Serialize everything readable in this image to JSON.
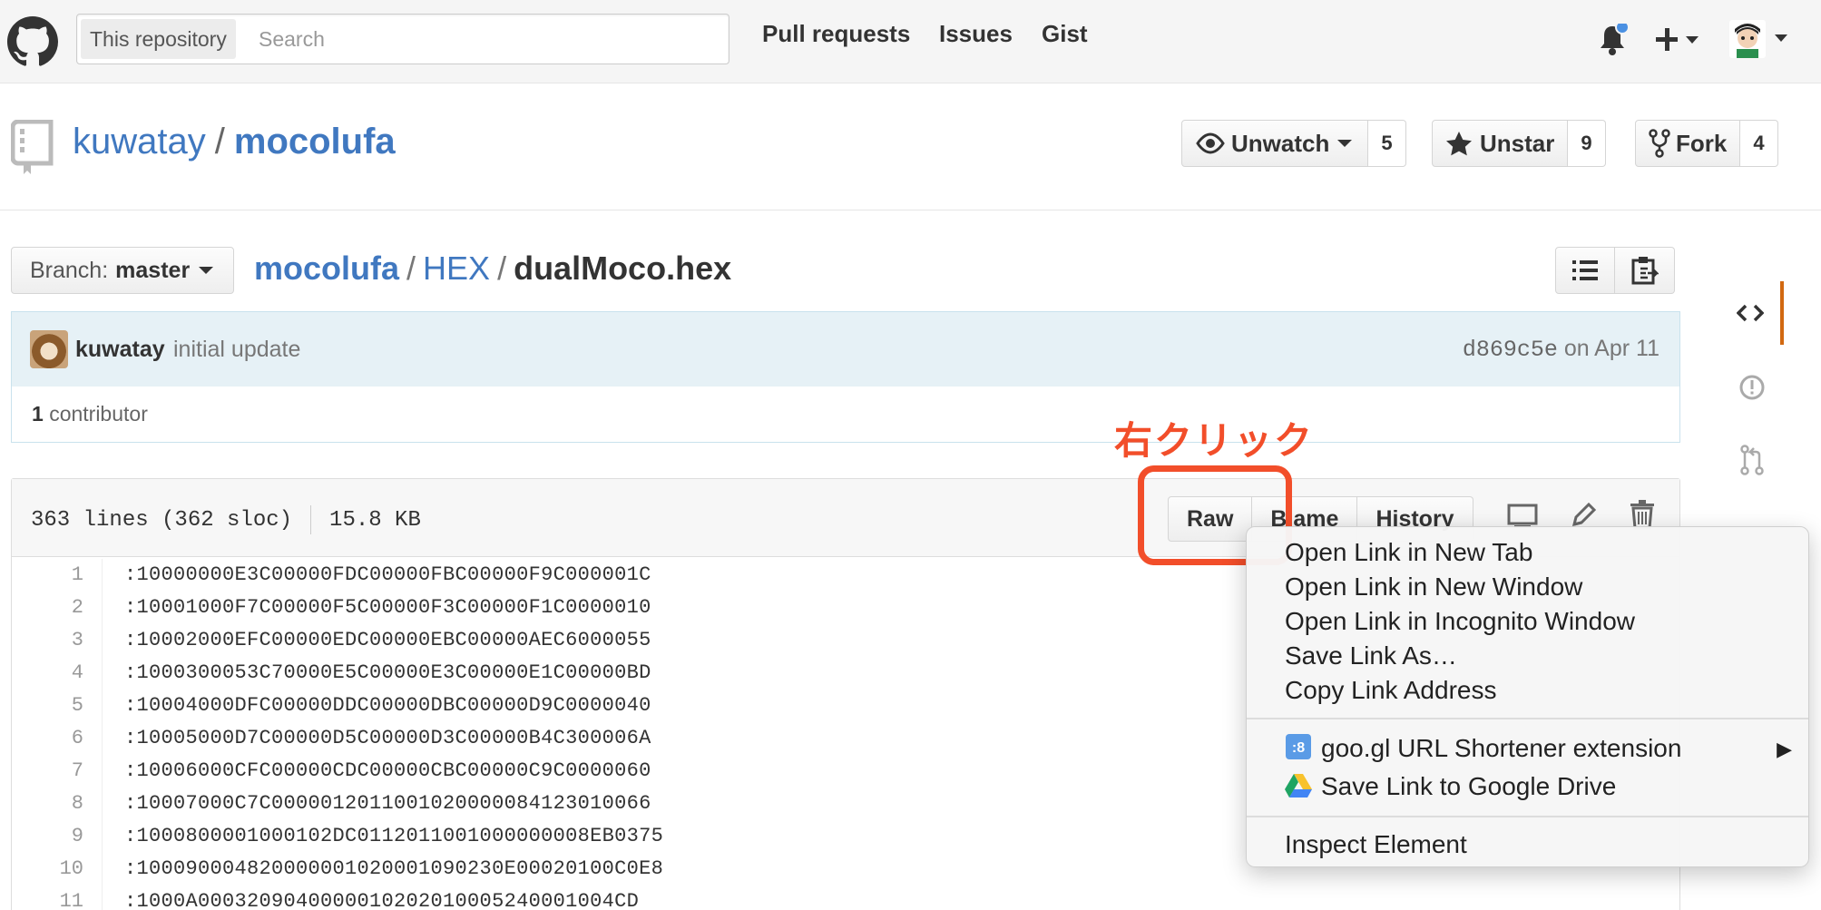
{
  "header": {
    "search_scope": "This repository",
    "search_placeholder": "Search",
    "nav": [
      "Pull requests",
      "Issues",
      "Gist"
    ]
  },
  "repo": {
    "owner": "kuwatay",
    "name": "mocolufa",
    "separator": "/",
    "unwatch_label": "Unwatch",
    "watch_count": "5",
    "unstar_label": "Unstar",
    "star_count": "9",
    "fork_label": "Fork",
    "fork_count": "4"
  },
  "breadcrumb": {
    "branch_prefix": "Branch:",
    "branch": "master",
    "root": "mocolufa",
    "dir": "HEX",
    "file": "dualMoco.hex",
    "sep": "/"
  },
  "commit": {
    "author": "kuwatay",
    "message": "initial update",
    "sha": "d869c5e",
    "date": "on Apr 11",
    "contributors_count": "1",
    "contributors_label": "contributor"
  },
  "file": {
    "lines": "363 lines (362 sloc)",
    "size": "15.8 KB",
    "raw_label": "Raw",
    "blame_label": "Blame",
    "history_label": "History",
    "code": [
      {
        "n": "1",
        "t": ":10000000E3C00000FDC00000FBC00000F9C000001C"
      },
      {
        "n": "2",
        "t": ":10001000F7C00000F5C00000F3C00000F1C0000010"
      },
      {
        "n": "3",
        "t": ":10002000EFC00000EDC00000EBC00000AEC6000055"
      },
      {
        "n": "4",
        "t": ":1000300053C70000E5C00000E3C00000E1C00000BD"
      },
      {
        "n": "5",
        "t": ":10004000DFC00000DDC00000DBC00000D9C0000040"
      },
      {
        "n": "6",
        "t": ":10005000D7C00000D5C00000D3C00000B4C300006A"
      },
      {
        "n": "7",
        "t": ":10006000CFC00000CDC00000CBC00000C9C0000060"
      },
      {
        "n": "8",
        "t": ":10007000C7C0000012011001020000084123010066"
      },
      {
        "n": "9",
        "t": ":1000800001000102DC0112011001000000008EB0375"
      },
      {
        "n": "10",
        "t": ":100090004820000001020001090230E00020100C0E8"
      },
      {
        "n": "11",
        "t": ":1000A0003209040000010202010005240001004CD"
      }
    ]
  },
  "annotation": {
    "label": "右クリック",
    "color": "#f24e2a"
  },
  "context_menu": {
    "items": [
      "Open Link in New Tab",
      "Open Link in New Window",
      "Open Link in Incognito Window",
      "Save Link As…",
      "Copy Link Address"
    ],
    "extensions": [
      "goo.gl URL Shortener extension",
      "Save Link to Google Drive"
    ],
    "inspect": "Inspect Element",
    "submenu_arrow": "▶"
  },
  "colors": {
    "link": "#4078c0",
    "commit_bg": "#e6f1f6",
    "nav_active": "#d26911"
  }
}
